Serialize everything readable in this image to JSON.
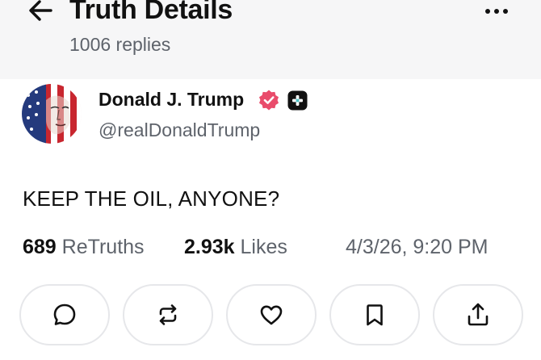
{
  "header": {
    "title": "Truth Details",
    "reply_count": "1006 replies",
    "back_icon": "arrow-left-icon",
    "more_icon": "more-horizontal-icon"
  },
  "post": {
    "author": {
      "name": "Donald J. Trump",
      "handle": "@realDonaldTrump",
      "verified": true,
      "verified_color": "#e94c6b"
    },
    "text": "KEEP THE OIL, ANYONE?",
    "stats": {
      "retruths_count": "689",
      "retruths_label": "ReTruths",
      "likes_count": "2.93k",
      "likes_label": "Likes",
      "timestamp": "4/3/26, 9:20 PM"
    }
  },
  "actions": [
    {
      "name": "reply",
      "icon": "comment-icon"
    },
    {
      "name": "retruth",
      "icon": "repost-icon"
    },
    {
      "name": "like",
      "icon": "heart-icon"
    },
    {
      "name": "bookmark",
      "icon": "bookmark-icon"
    },
    {
      "name": "share",
      "icon": "share-icon"
    }
  ],
  "colors": {
    "header_bg": "#f6f6f7",
    "secondary_text": "#5e636b",
    "button_border": "#e6e7ea"
  }
}
